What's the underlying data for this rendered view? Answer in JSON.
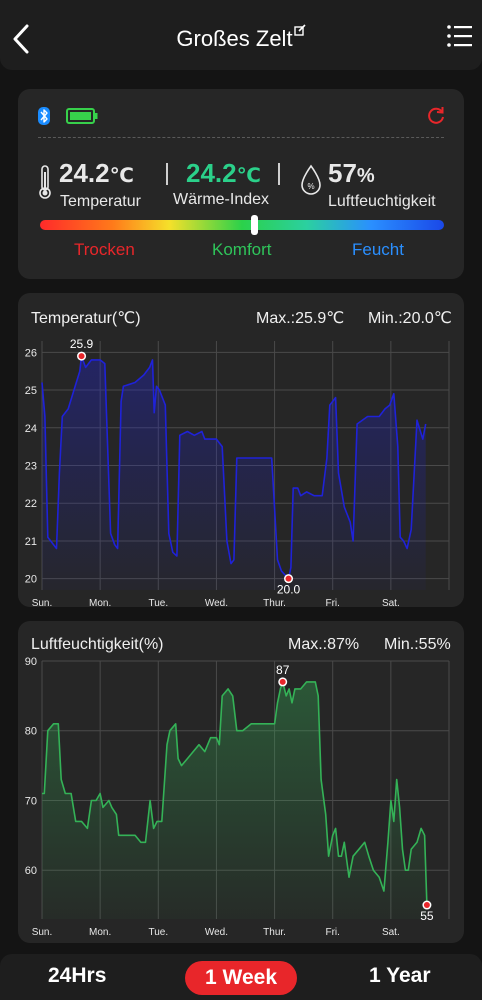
{
  "header": {
    "title": "Großes Zelt",
    "back_icon": "chevron-left-icon",
    "edit_icon": "edit-icon",
    "menu_icon": "list-menu-icon"
  },
  "status": {
    "bluetooth_icon": "bluetooth-icon",
    "battery_icon": "battery-full-icon",
    "refresh_icon": "refresh-icon",
    "battery_color": "#37d14b"
  },
  "current": {
    "temperature": {
      "value": "24.2",
      "unit": "℃",
      "label": "Temperatur",
      "icon": "thermometer-icon"
    },
    "heat_index": {
      "value": "24.2",
      "unit": "℃",
      "label": "Wärme-Index",
      "color": "#2bd08a"
    },
    "humidity": {
      "value": "57",
      "unit": "%",
      "label": "Luftfeuchtigkeit",
      "icon": "humidity-drop-icon"
    }
  },
  "comfort": {
    "level": 0.53,
    "zones": {
      "dry": "Trocken",
      "comfort": "Komfort",
      "humid": "Feucht"
    },
    "colors": {
      "dry": "#e8262a",
      "comfort": "#2fc45a",
      "humid": "#2a8fff"
    }
  },
  "temp_chart": {
    "title": "Temperatur(℃)",
    "max_label": "Max.:25.9℃",
    "min_label": "Min.:20.0℃",
    "max_marker": "25.9",
    "min_marker": "20.0"
  },
  "hum_chart": {
    "title": "Luftfeuchtigkeit(%)",
    "max_label": "Max.:87%",
    "min_label": "Min.:55%",
    "max_marker": "87",
    "min_marker": "55"
  },
  "range_tabs": {
    "day": "24Hrs",
    "week": "1 Week",
    "year": "1 Year",
    "selected": "week"
  },
  "chart_data": [
    {
      "type": "area",
      "title": "Temperatur(℃)",
      "x_categories": [
        "Sun.",
        "Mon.",
        "Tue.",
        "Wed.",
        "Thur.",
        "Fri.",
        "Sat."
      ],
      "x_domain": [
        0,
        7
      ],
      "ylim": [
        19.7,
        26.3
      ],
      "yticks": [
        20,
        21,
        22,
        23,
        24,
        25,
        26
      ],
      "grid": true,
      "color": "#1f22d8",
      "max": {
        "x": 0.68,
        "y": 25.9
      },
      "min": {
        "x": 4.24,
        "y": 20.0
      },
      "series": [
        {
          "values": [
            [
              0,
              25.2
            ],
            [
              0.05,
              24.3
            ],
            [
              0.1,
              21.1
            ],
            [
              0.2,
              20.9
            ],
            [
              0.25,
              20.8
            ],
            [
              0.3,
              22.8
            ],
            [
              0.35,
              24.3
            ],
            [
              0.45,
              24.5
            ],
            [
              0.55,
              25.0
            ],
            [
              0.65,
              25.5
            ],
            [
              0.68,
              25.9
            ],
            [
              0.75,
              25.6
            ],
            [
              0.85,
              25.8
            ],
            [
              1.0,
              25.8
            ],
            [
              1.08,
              25.7
            ],
            [
              1.18,
              21.2
            ],
            [
              1.25,
              20.9
            ],
            [
              1.3,
              20.8
            ],
            [
              1.36,
              24.7
            ],
            [
              1.4,
              25.1
            ],
            [
              1.6,
              25.2
            ],
            [
              1.75,
              25.4
            ],
            [
              1.85,
              25.6
            ],
            [
              1.9,
              25.8
            ],
            [
              1.93,
              24.4
            ],
            [
              1.97,
              25.1
            ],
            [
              2.02,
              25.0
            ],
            [
              2.12,
              24.6
            ],
            [
              2.18,
              21.2
            ],
            [
              2.25,
              20.7
            ],
            [
              2.32,
              20.6
            ],
            [
              2.37,
              23.8
            ],
            [
              2.5,
              23.9
            ],
            [
              2.62,
              23.8
            ],
            [
              2.75,
              23.9
            ],
            [
              2.8,
              23.7
            ],
            [
              3.0,
              23.7
            ],
            [
              3.1,
              23.5
            ],
            [
              3.18,
              21.0
            ],
            [
              3.25,
              20.4
            ],
            [
              3.3,
              20.5
            ],
            [
              3.35,
              23.2
            ],
            [
              3.55,
              23.2
            ],
            [
              3.7,
              23.2
            ],
            [
              3.83,
              23.2
            ],
            [
              3.95,
              23.2
            ],
            [
              4.05,
              20.5
            ],
            [
              4.12,
              20.2
            ],
            [
              4.18,
              20.1
            ],
            [
              4.24,
              20.0
            ],
            [
              4.28,
              20.3
            ],
            [
              4.32,
              22.4
            ],
            [
              4.4,
              22.4
            ],
            [
              4.45,
              22.2
            ],
            [
              4.55,
              22.3
            ],
            [
              4.68,
              22.2
            ],
            [
              4.82,
              22.2
            ],
            [
              4.9,
              23.2
            ],
            [
              4.95,
              24.6
            ],
            [
              5.05,
              24.8
            ],
            [
              5.1,
              22.8
            ],
            [
              5.2,
              21.9
            ],
            [
              5.3,
              21.5
            ],
            [
              5.35,
              21.0
            ],
            [
              5.42,
              24.1
            ],
            [
              5.6,
              24.3
            ],
            [
              5.8,
              24.3
            ],
            [
              5.9,
              24.5
            ],
            [
              5.98,
              24.6
            ],
            [
              6.05,
              24.9
            ],
            [
              6.12,
              23.5
            ],
            [
              6.16,
              21.1
            ],
            [
              6.22,
              21.0
            ],
            [
              6.28,
              20.8
            ],
            [
              6.35,
              21.3
            ],
            [
              6.45,
              24.2
            ],
            [
              6.55,
              23.7
            ],
            [
              6.6,
              24.1
            ]
          ]
        }
      ]
    },
    {
      "type": "area",
      "title": "Luftfeuchtigkeit(%)",
      "x_categories": [
        "Sun.",
        "Mon.",
        "Tue.",
        "Wed.",
        "Thur.",
        "Fri.",
        "Sat."
      ],
      "x_domain": [
        0,
        7
      ],
      "ylim": [
        53,
        90
      ],
      "yticks": [
        60,
        70,
        80,
        90
      ],
      "grid": true,
      "color": "#34b257",
      "max": {
        "x": 4.14,
        "y": 87
      },
      "min": {
        "x": 6.62,
        "y": 55
      },
      "series": [
        {
          "values": [
            [
              0,
              71
            ],
            [
              0.04,
              71
            ],
            [
              0.1,
              80
            ],
            [
              0.2,
              81
            ],
            [
              0.28,
              81
            ],
            [
              0.33,
              73
            ],
            [
              0.4,
              71
            ],
            [
              0.5,
              71
            ],
            [
              0.58,
              67
            ],
            [
              0.68,
              67
            ],
            [
              0.78,
              66
            ],
            [
              0.85,
              70
            ],
            [
              0.93,
              70
            ],
            [
              1.0,
              71
            ],
            [
              1.05,
              69
            ],
            [
              1.15,
              70
            ],
            [
              1.2,
              69
            ],
            [
              1.28,
              68
            ],
            [
              1.32,
              65
            ],
            [
              1.45,
              65
            ],
            [
              1.6,
              65
            ],
            [
              1.7,
              64
            ],
            [
              1.78,
              64
            ],
            [
              1.86,
              70
            ],
            [
              1.92,
              66
            ],
            [
              1.98,
              67
            ],
            [
              2.06,
              67
            ],
            [
              2.15,
              78
            ],
            [
              2.2,
              80
            ],
            [
              2.3,
              81
            ],
            [
              2.34,
              76
            ],
            [
              2.4,
              75
            ],
            [
              2.5,
              76
            ],
            [
              2.6,
              77
            ],
            [
              2.7,
              78
            ],
            [
              2.8,
              77
            ],
            [
              2.9,
              79
            ],
            [
              3.0,
              79
            ],
            [
              3.05,
              78
            ],
            [
              3.1,
              85
            ],
            [
              3.2,
              86
            ],
            [
              3.28,
              85
            ],
            [
              3.35,
              80
            ],
            [
              3.45,
              80
            ],
            [
              3.6,
              81
            ],
            [
              3.75,
              81
            ],
            [
              3.9,
              81
            ],
            [
              4.0,
              81
            ],
            [
              4.05,
              84
            ],
            [
              4.1,
              86
            ],
            [
              4.14,
              87
            ],
            [
              4.2,
              85
            ],
            [
              4.25,
              86
            ],
            [
              4.3,
              84
            ],
            [
              4.35,
              86
            ],
            [
              4.45,
              86
            ],
            [
              4.55,
              87
            ],
            [
              4.7,
              87
            ],
            [
              4.75,
              85
            ],
            [
              4.8,
              73
            ],
            [
              4.88,
              68
            ],
            [
              4.93,
              62
            ],
            [
              5.0,
              65
            ],
            [
              5.05,
              66
            ],
            [
              5.1,
              62
            ],
            [
              5.15,
              62
            ],
            [
              5.2,
              64
            ],
            [
              5.28,
              59
            ],
            [
              5.35,
              62
            ],
            [
              5.45,
              63
            ],
            [
              5.55,
              64
            ],
            [
              5.62,
              62
            ],
            [
              5.7,
              60
            ],
            [
              5.8,
              59
            ],
            [
              5.88,
              57
            ],
            [
              5.95,
              64
            ],
            [
              6.0,
              70
            ],
            [
              6.05,
              67
            ],
            [
              6.1,
              73
            ],
            [
              6.15,
              69
            ],
            [
              6.2,
              63
            ],
            [
              6.25,
              60
            ],
            [
              6.3,
              60
            ],
            [
              6.35,
              63
            ],
            [
              6.45,
              64
            ],
            [
              6.52,
              66
            ],
            [
              6.58,
              65
            ],
            [
              6.62,
              55
            ]
          ]
        }
      ]
    }
  ]
}
